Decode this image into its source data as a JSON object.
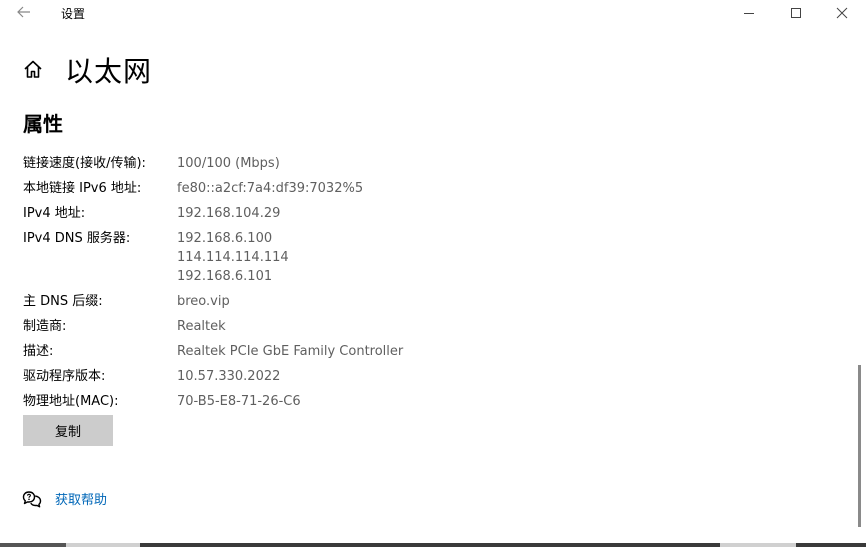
{
  "window": {
    "title": "设置"
  },
  "page": {
    "title": "以太网"
  },
  "properties": {
    "heading": "属性",
    "rows": [
      {
        "label": "链接速度(接收/传输):",
        "values": [
          "100/100 (Mbps)"
        ]
      },
      {
        "label": "本地链接 IPv6 地址:",
        "values": [
          "fe80::a2cf:7a4:df39:7032%5"
        ]
      },
      {
        "label": "IPv4 地址:",
        "values": [
          "192.168.104.29"
        ]
      },
      {
        "label": "IPv4 DNS 服务器:",
        "values": [
          "192.168.6.100",
          "114.114.114.114",
          "192.168.6.101"
        ]
      },
      {
        "label": "主 DNS 后缀:",
        "values": [
          "breo.vip"
        ]
      },
      {
        "label": "制造商:",
        "values": [
          "Realtek"
        ]
      },
      {
        "label": "描述:",
        "values": [
          "Realtek PCIe GbE Family Controller"
        ]
      },
      {
        "label": "驱动程序版本:",
        "values": [
          "10.57.330.2022"
        ]
      },
      {
        "label": "物理地址(MAC):",
        "values": [
          "70-B5-E8-71-26-C6"
        ]
      }
    ],
    "copy_label": "复制"
  },
  "help": {
    "label": "获取帮助",
    "icon": "help-chat-icon"
  },
  "colors": {
    "link": "#0067b8",
    "value_text": "#5f5f5f",
    "button_bg": "#cccccc"
  }
}
